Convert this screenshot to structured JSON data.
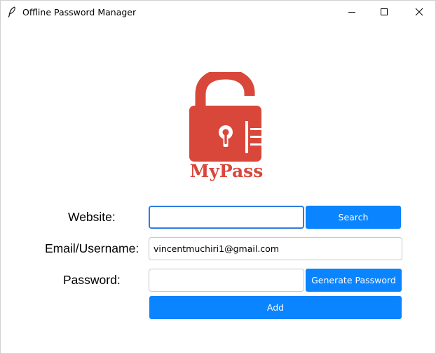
{
  "window": {
    "title": "Offline Password Manager",
    "app_icon": "feather-icon"
  },
  "logo": {
    "icon": "unlocked-padlock-icon",
    "text": "MyPass",
    "color": "#d9473b"
  },
  "form": {
    "website_label": "Website:",
    "website_value": "",
    "email_label": "Email/Username:",
    "email_value": "vincentmuchiri1@gmail.com",
    "password_label": "Password:",
    "password_value": "",
    "search_button": "Search",
    "generate_button": "Generate Password",
    "add_button": "Add"
  },
  "colors": {
    "button_blue": "#0a84ff",
    "focus_border": "#2f7ee0"
  }
}
